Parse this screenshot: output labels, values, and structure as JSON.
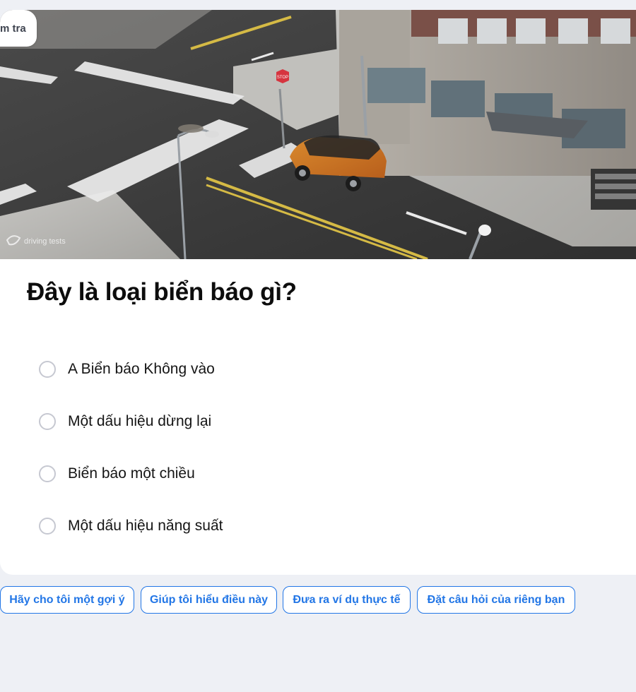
{
  "badge": {
    "label": "m tra"
  },
  "image": {
    "watermark": "driving tests",
    "stop_sign_text": "STOP"
  },
  "question": {
    "text": "Đây là loại biển báo gì?"
  },
  "options": [
    {
      "label": "A Biển báo Không vào"
    },
    {
      "label": "Một dấu hiệu dừng lại"
    },
    {
      "label": "Biển báo một chiều"
    },
    {
      "label": "Một dấu hiệu năng suất"
    }
  ],
  "suggestions": [
    {
      "label": "Hãy cho tôi một gợi ý"
    },
    {
      "label": "Giúp tôi hiểu điều này"
    },
    {
      "label": "Đưa ra ví dụ thực tế"
    },
    {
      "label": "Đặt câu hỏi của riêng bạn"
    }
  ]
}
